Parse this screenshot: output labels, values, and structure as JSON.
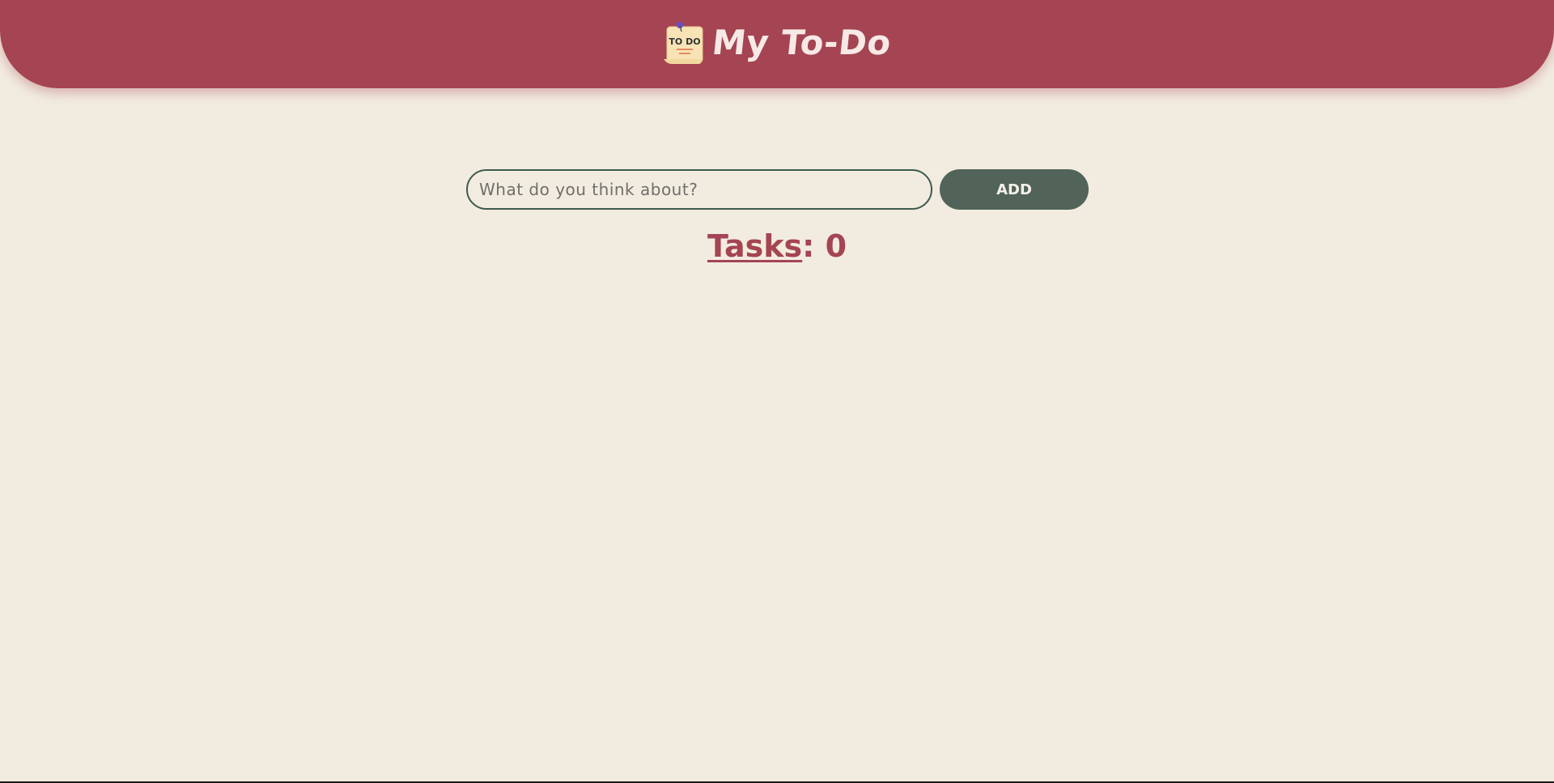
{
  "header": {
    "title": "My To-Do",
    "logo_text": "TO DO"
  },
  "form": {
    "input_placeholder": "What do you think about?",
    "input_value": "",
    "add_label": "ADD"
  },
  "counter": {
    "label": "Tasks",
    "separator": ": ",
    "count": "0"
  },
  "colors": {
    "background": "#f2ece0",
    "header": "#a54452",
    "button": "#526459",
    "accent_text": "#a54452"
  },
  "icons": {
    "logo": "todo-note-icon"
  }
}
